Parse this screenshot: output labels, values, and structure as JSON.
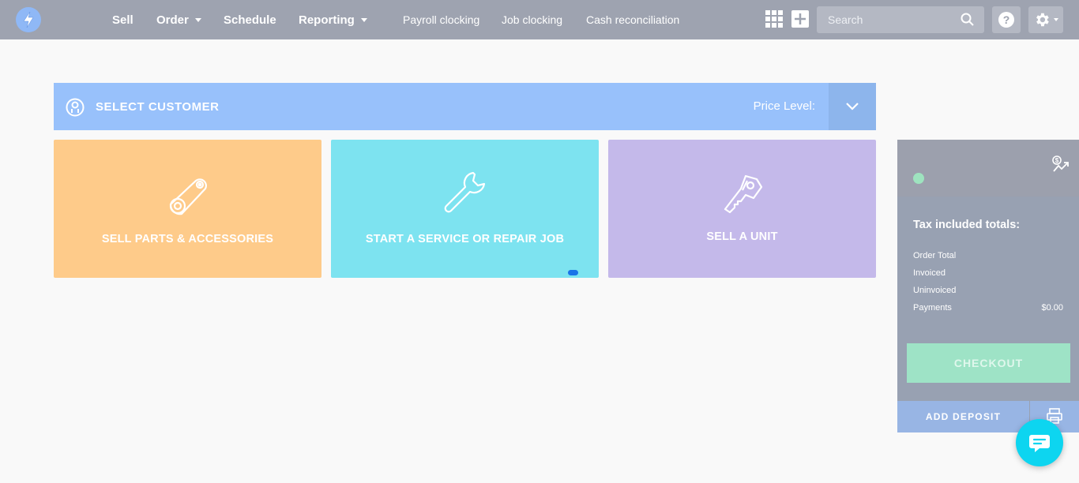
{
  "nav": {
    "sell": "Sell",
    "order": "Order",
    "schedule": "Schedule",
    "reporting": "Reporting",
    "payroll": "Payroll clocking",
    "job_clocking": "Job clocking",
    "cash": "Cash reconciliation",
    "search_placeholder": "Search"
  },
  "customer": {
    "label": "SELECT CUSTOMER",
    "price_level": "Price Level:"
  },
  "tiles": [
    {
      "label": "SELL PARTS & ACCESSORIES",
      "icon": "timing-belt-icon",
      "color": "#fecb8a"
    },
    {
      "label": "START A SERVICE OR REPAIR JOB",
      "icon": "wrench-icon",
      "color": "#7de3f0"
    },
    {
      "label": "SELL A UNIT",
      "icon": "key-icon",
      "color": "#c4b9ea"
    }
  ],
  "panel": {
    "totals_title": "Tax included totals:",
    "rows": [
      {
        "label": "Order Total",
        "value": ""
      },
      {
        "label": "Invoiced",
        "value": ""
      },
      {
        "label": "Uninvoiced",
        "value": ""
      },
      {
        "label": "Payments",
        "value": "$0.00"
      }
    ],
    "checkout": "CHECKOUT",
    "deposit": "ADD DEPOSIT"
  },
  "colors": {
    "nav_bg": "#9ea3b0",
    "customer_bar": "#98c1fb",
    "checkout": "#9ee3c6",
    "chat": "#0dd5f0"
  }
}
